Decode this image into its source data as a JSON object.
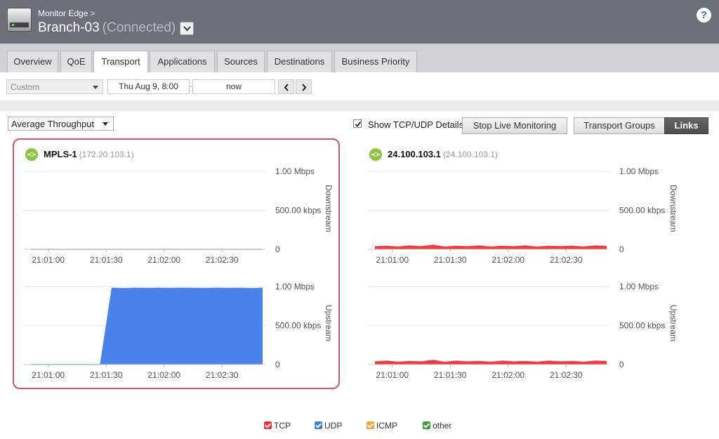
{
  "header": {
    "breadcrumb": "Monitor Edge",
    "breadcrumb_sep": ">",
    "edge_name": "Branch-03",
    "edge_status": "(Connected)",
    "help": "?"
  },
  "tabs": [
    {
      "label": "Overview"
    },
    {
      "label": "QoE"
    },
    {
      "label": "Transport"
    },
    {
      "label": "Applications"
    },
    {
      "label": "Sources"
    },
    {
      "label": "Destinations"
    },
    {
      "label": "Business Priority"
    }
  ],
  "active_tab": "Transport",
  "toolbar": {
    "range": "Custom",
    "start": "Thu Aug 9, 8:00",
    "end": "now"
  },
  "controls": {
    "metric": "Average Throughput",
    "show_details_label": "Show TCP/UDP Details",
    "show_details_checked": true,
    "stop_live": "Stop Live Monitoring",
    "view_groups": "Transport Groups",
    "view_links": "Links",
    "selected_view": "Links"
  },
  "panels": [
    {
      "name": "MPLS-1",
      "ip": "(172.20.103.1)"
    },
    {
      "name": "24.100.103.1",
      "ip": "(24.100.103.1)"
    }
  ],
  "chart_data": [
    {
      "type": "area",
      "link": "MPLS-1",
      "direction_label": "Downstream",
      "x": [
        "21:01:00",
        "21:01:30",
        "21:02:00",
        "21:02:30"
      ],
      "yticks": [
        "1.00 Mbps",
        "500.00 kbps",
        "0"
      ],
      "ylim": [
        0,
        1000
      ],
      "series": [
        {
          "name": "UDP",
          "color": "#3f7be8",
          "values": [
            0,
            0,
            0,
            0,
            0,
            0,
            0,
            0,
            0,
            0
          ]
        }
      ]
    },
    {
      "type": "area",
      "link": "MPLS-1",
      "direction_label": "Upstream",
      "x": [
        "21:01:00",
        "21:01:30",
        "21:02:00",
        "21:02:30"
      ],
      "yticks": [
        "1.00 Mbps",
        "500.00 kbps",
        "0"
      ],
      "ylim": [
        0,
        1000
      ],
      "series": [
        {
          "name": "UDP",
          "color": "#3f7be8",
          "values": [
            0,
            0,
            0,
            0,
            0,
            0,
            0,
            980,
            975,
            980,
            978,
            980,
            977,
            980,
            979,
            976,
            980,
            978,
            980,
            975,
            980
          ]
        }
      ]
    },
    {
      "type": "area",
      "link": "24.100.103.1",
      "direction_label": "Downstream",
      "x": [
        "21:01:00",
        "21:01:30",
        "21:02:00",
        "21:02:30"
      ],
      "yticks": [
        "1.00 Mbps",
        "500.00 kbps",
        "0"
      ],
      "ylim": [
        0,
        1000
      ],
      "series": [
        {
          "name": "TCP",
          "color": "#e8343a",
          "values": [
            35,
            40,
            30,
            45,
            35,
            55,
            30,
            40,
            35,
            45,
            30,
            40,
            35,
            45,
            30,
            40,
            35,
            42,
            30,
            45,
            38
          ]
        }
      ]
    },
    {
      "type": "area",
      "link": "24.100.103.1",
      "direction_label": "Upstream",
      "x": [
        "21:01:00",
        "21:01:30",
        "21:02:00",
        "21:02:30"
      ],
      "yticks": [
        "1.00 Mbps",
        "500.00 kbps",
        "0"
      ],
      "ylim": [
        0,
        1000
      ],
      "series": [
        {
          "name": "TCP",
          "color": "#e8343a",
          "values": [
            35,
            45,
            30,
            40,
            35,
            55,
            30,
            45,
            35,
            40,
            30,
            45,
            35,
            40,
            30,
            45,
            35,
            40,
            30,
            45,
            40
          ]
        }
      ]
    }
  ],
  "legend": [
    {
      "label": "TCP",
      "color": "#e8343a"
    },
    {
      "label": "UDP",
      "color": "#3f7be8"
    },
    {
      "label": "ICMP",
      "color": "#f5a340"
    },
    {
      "label": "other",
      "color": "#3aa13a"
    }
  ]
}
